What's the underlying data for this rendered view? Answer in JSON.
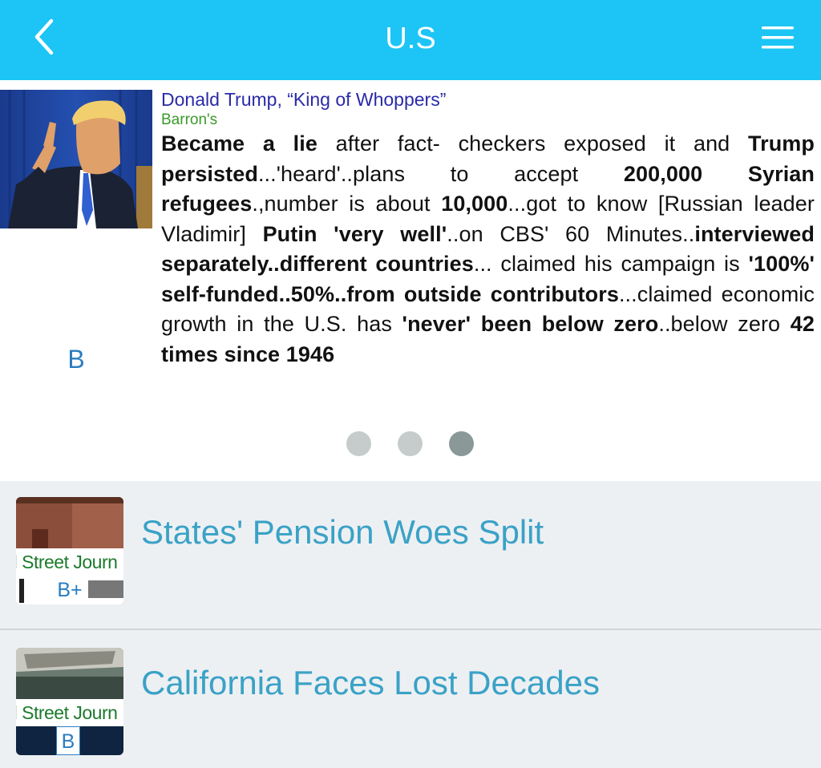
{
  "header": {
    "title": "U.S",
    "back_icon": "chevron-left-icon",
    "menu_icon": "hamburger-menu-icon",
    "bar_color": "#1cc5f5"
  },
  "featured": {
    "headline": "Donald Trump, “King of Whoppers”",
    "source": "Barron's",
    "grade": "B",
    "summary": [
      {
        "t": "Became a lie",
        "b": true
      },
      {
        "t": " after fact- checkers exposed it and ",
        "b": false
      },
      {
        "t": "Trump persisted",
        "b": true
      },
      {
        "t": "...'heard'..plans to accept ",
        "b": false
      },
      {
        "t": "200,000 Syrian refugees",
        "b": true
      },
      {
        "t": ".,number is about ",
        "b": false
      },
      {
        "t": "10,000",
        "b": true
      },
      {
        "t": "...got to know [Russian leader Vladimir] ",
        "b": false
      },
      {
        "t": "Putin 'very well'",
        "b": true
      },
      {
        "t": "..on CBS' 60 Minutes..",
        "b": false
      },
      {
        "t": "interviewed separately..different countries",
        "b": true
      },
      {
        "t": "... claimed his campaign is ",
        "b": false
      },
      {
        "t": "'100%' self-funded..50%..from outside contributors",
        "b": true
      },
      {
        "t": "...claimed economic growth in the U.S. has ",
        "b": false
      },
      {
        "t": "'never' been below zero",
        "b": true
      },
      {
        "t": "..below zero ",
        "b": false
      },
      {
        "t": "42 times since 1946",
        "b": true
      }
    ],
    "carousel": {
      "total": 3,
      "active_index": 2
    }
  },
  "list": [
    {
      "title": "States' Pension Woes Split",
      "source": "ll Street Journ",
      "grade": "B+",
      "grade_style": "plain"
    },
    {
      "title": "California Faces Lost Decades",
      "source": "ll Street Journ",
      "grade": "B",
      "grade_style": "boxed"
    }
  ],
  "colors": {
    "headline": "#2a2aa8",
    "source": "#3a9a2a",
    "grade": "#2b7dc0",
    "list_title": "#3aa2c6",
    "list_bg": "#edf0f3",
    "dot": "#c6cccc",
    "dot_active": "#8a9898"
  }
}
